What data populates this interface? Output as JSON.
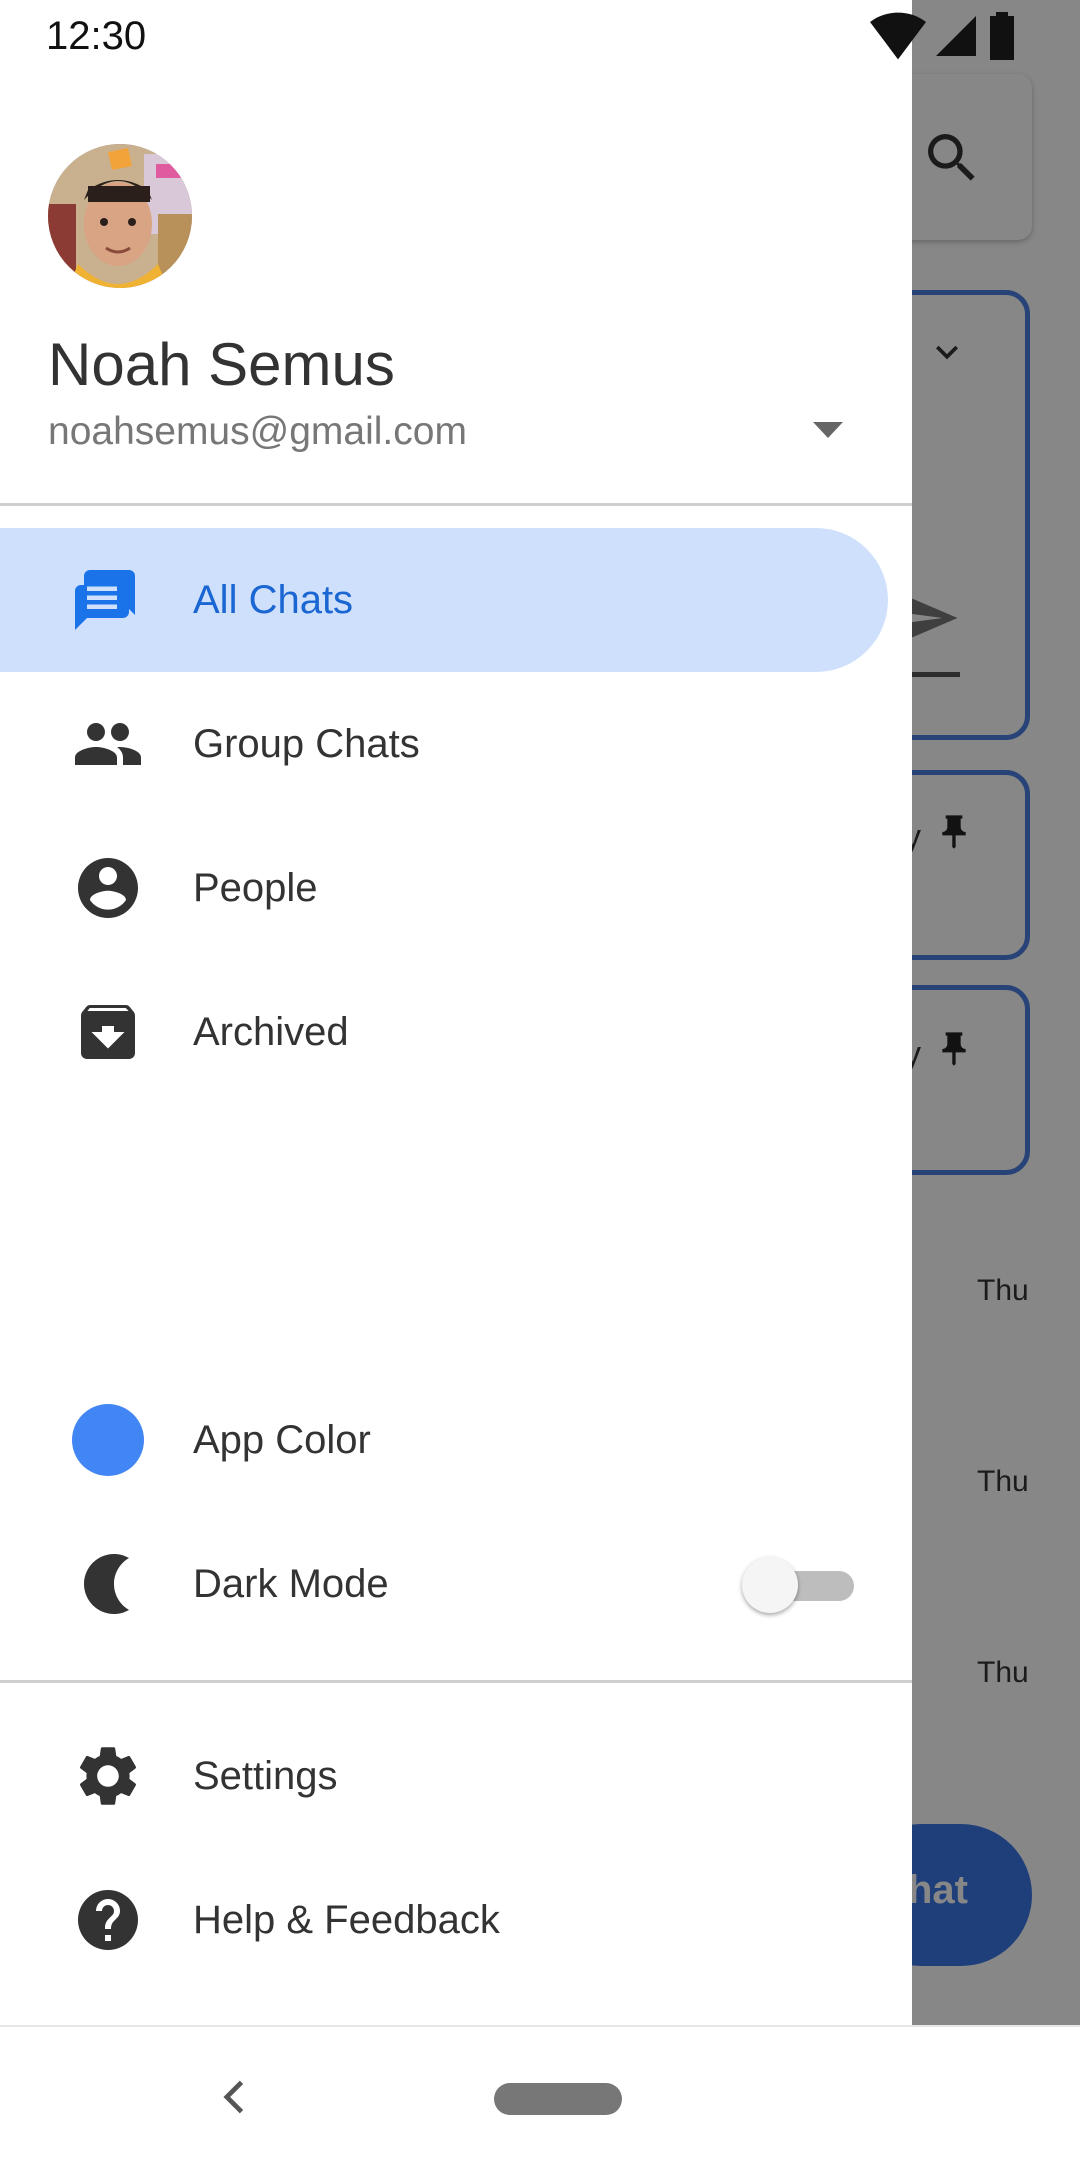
{
  "status_bar": {
    "time": "12:30"
  },
  "drawer": {
    "account": {
      "name": "Noah Semus",
      "email": "noahsemus@gmail.com"
    },
    "nav_items": [
      {
        "label": "All Chats",
        "icon": "chat-icon",
        "active": true
      },
      {
        "label": "Group Chats",
        "icon": "group-icon"
      },
      {
        "label": "People",
        "icon": "person-icon"
      },
      {
        "label": "Archived",
        "icon": "archive-icon"
      }
    ],
    "app_color": {
      "label": "App Color",
      "color": "#4285f4"
    },
    "dark_mode": {
      "label": "Dark Mode",
      "enabled": false
    },
    "footer_items": [
      {
        "label": "Settings",
        "icon": "gear-icon"
      },
      {
        "label": "Help & Feedback",
        "icon": "help-icon"
      }
    ]
  },
  "background": {
    "times": [
      "Thu",
      "Thu",
      "Thu"
    ],
    "fab_label_fragment": "hat",
    "fragments": [
      "y",
      "y"
    ]
  },
  "colors": {
    "accent": "#1a66d2",
    "active_bg": "#cfe0fc"
  }
}
